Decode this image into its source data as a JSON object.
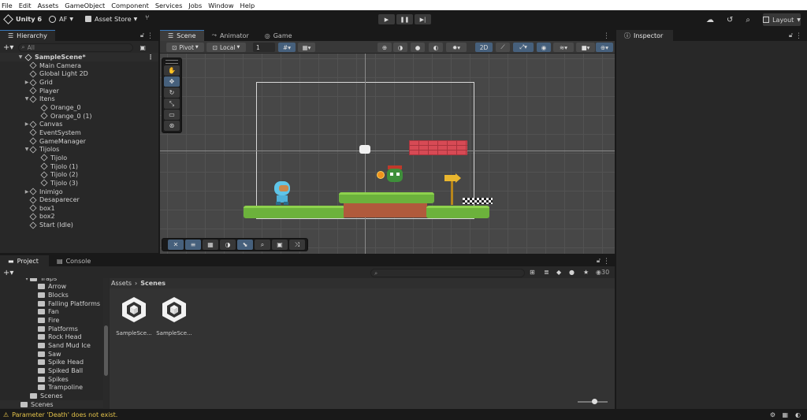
{
  "menu": [
    "File",
    "Edit",
    "Assets",
    "GameObject",
    "Component",
    "Services",
    "Jobs",
    "Window",
    "Help"
  ],
  "topbar": {
    "app_label": "Unity 6",
    "account": "AF",
    "asset_store": "Asset Store",
    "layout": "Layout"
  },
  "hierarchy": {
    "tab": "Hierarchy",
    "search_placeholder": "All",
    "scene": "SampleScene*",
    "items": [
      {
        "label": "Main Camera",
        "depth": 1,
        "expand": false
      },
      {
        "label": "Global Light 2D",
        "depth": 1,
        "expand": false
      },
      {
        "label": "Grid",
        "depth": 1,
        "expand": true
      },
      {
        "label": "Player",
        "depth": 1,
        "expand": false
      },
      {
        "label": "Itens",
        "depth": 1,
        "expand": "open"
      },
      {
        "label": "Orange_0",
        "depth": 2,
        "expand": false
      },
      {
        "label": "Orange_0 (1)",
        "depth": 2,
        "expand": false
      },
      {
        "label": "Canvas",
        "depth": 1,
        "expand": true
      },
      {
        "label": "EventSystem",
        "depth": 1,
        "expand": false
      },
      {
        "label": "GameManager",
        "depth": 1,
        "expand": false
      },
      {
        "label": "Tijolos",
        "depth": 1,
        "expand": "open"
      },
      {
        "label": "Tijolo",
        "depth": 2,
        "expand": false
      },
      {
        "label": "Tijolo (1)",
        "depth": 2,
        "expand": false
      },
      {
        "label": "Tijolo (2)",
        "depth": 2,
        "expand": false
      },
      {
        "label": "Tijolo (3)",
        "depth": 2,
        "expand": false
      },
      {
        "label": "Inimigo",
        "depth": 1,
        "expand": true
      },
      {
        "label": "Desaparecer",
        "depth": 1,
        "expand": false
      },
      {
        "label": "box1",
        "depth": 1,
        "expand": false
      },
      {
        "label": "box2",
        "depth": 1,
        "expand": false
      },
      {
        "label": "Start (Idle)",
        "depth": 1,
        "expand": false
      }
    ]
  },
  "scene": {
    "tabs": [
      "Scene",
      "Animator",
      "Game"
    ],
    "pivot": "Pivot",
    "local": "Local",
    "snap_value": "1",
    "mode_2d": "2D"
  },
  "inspector": {
    "tab": "Inspector"
  },
  "project": {
    "tabs": [
      "Project",
      "Console"
    ],
    "count": "30",
    "breadcrumb_root": "Assets",
    "breadcrumb_current": "Scenes",
    "tree": [
      {
        "label": "Traps",
        "indent": 1
      },
      {
        "label": "Arrow",
        "indent": 2
      },
      {
        "label": "Blocks",
        "indent": 2
      },
      {
        "label": "Falling Platforms",
        "indent": 2
      },
      {
        "label": "Fan",
        "indent": 2
      },
      {
        "label": "Fire",
        "indent": 2
      },
      {
        "label": "Platforms",
        "indent": 2
      },
      {
        "label": "Rock Head",
        "indent": 2
      },
      {
        "label": "Sand Mud Ice",
        "indent": 2
      },
      {
        "label": "Saw",
        "indent": 2
      },
      {
        "label": "Spike Head",
        "indent": 2
      },
      {
        "label": "Spiked Ball",
        "indent": 2
      },
      {
        "label": "Spikes",
        "indent": 2
      },
      {
        "label": "Trampoline",
        "indent": 2
      },
      {
        "label": "Scenes",
        "indent": 1
      },
      {
        "label": "Scenes",
        "indent": 0
      }
    ],
    "assets": [
      "SampleSce...",
      "SampleSce..."
    ]
  },
  "status": {
    "message": "Parameter 'Death' does not exist."
  }
}
